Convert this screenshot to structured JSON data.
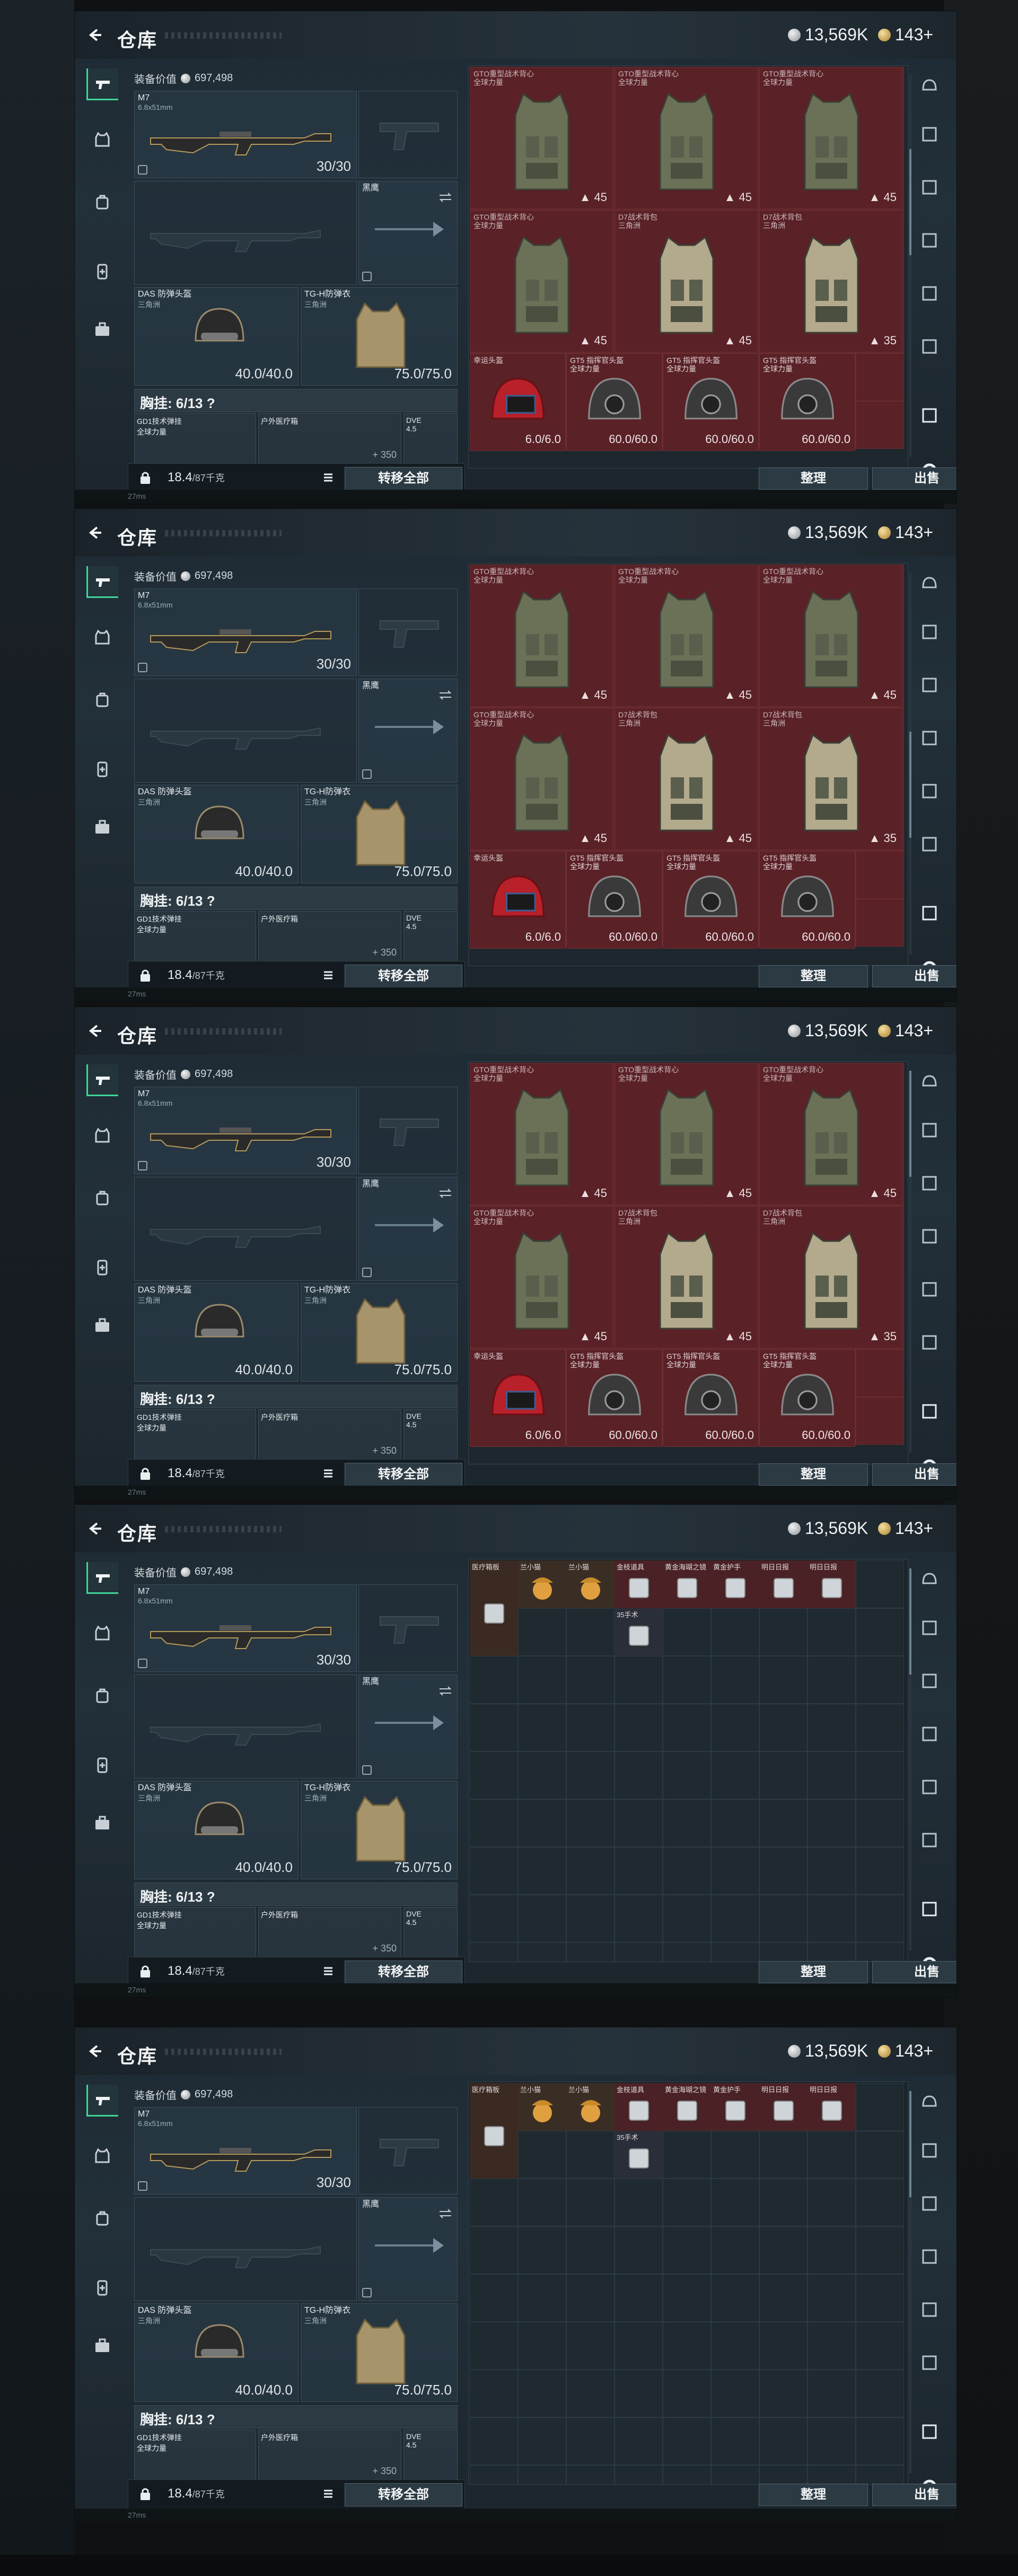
{
  "page": {
    "title": "仓库"
  },
  "currency": {
    "silver": "13,569K",
    "gold": "143+"
  },
  "equipment": {
    "label": "装备价值",
    "value": "697,498",
    "primary": {
      "name": "M7",
      "caliber": "6.8x51mm",
      "ammo": "30/30"
    },
    "secondary_tag": "黑鹰",
    "helmet": {
      "name": "DAS 防弹头盔",
      "sub": "三角洲",
      "durability": "40.0/40.0"
    },
    "armor": {
      "name": "TG-H防弹衣",
      "sub": "三角洲",
      "durability": "75.0/75.0"
    },
    "chest_rig": "胸挂: 6/13 ?",
    "chest_slots": [
      {
        "name": "GD1技术弹挂",
        "sub": "全球力量"
      },
      {
        "name": "户外医疗箱",
        "sub": ""
      },
      {
        "name": "DVE",
        "sub": "4.5"
      }
    ],
    "chest_value": "+ 350"
  },
  "weight": {
    "current": "18.4",
    "max": "/87千克"
  },
  "actions": {
    "transfer_all": "转移全部",
    "sort": "整理",
    "sell": "出售"
  },
  "grid_items_red": {
    "rigs": [
      {
        "name": "GTO重型战术背心",
        "sub": "全球力量",
        "level": "45"
      },
      {
        "name": "GTO重型战术背心",
        "sub": "全球力量",
        "level": "45"
      },
      {
        "name": "GTO重型战术背心",
        "sub": "全球力量",
        "level": "45"
      },
      {
        "name": "GTO重型战术背心",
        "sub": "全球力量",
        "level": "45"
      },
      {
        "name": "D7战术背包",
        "sub": "三角洲",
        "level": "45"
      },
      {
        "name": "D7战术背包",
        "sub": "三角洲",
        "level": "35"
      }
    ],
    "helmets": [
      {
        "name": "幸运头盔",
        "sub": "",
        "durability": "6.0/6.0"
      },
      {
        "name": "GT5 指挥官头盔",
        "sub": "全球力量",
        "durability": "60.0/60.0"
      },
      {
        "name": "GT5 指挥官头盔",
        "sub": "全球力量",
        "durability": "60.0/60.0"
      },
      {
        "name": "GT5 指挥官头盔",
        "sub": "全球力量",
        "durability": "60.0/60.0"
      }
    ]
  },
  "grid_items_misc": [
    {
      "name": "医疗箱板"
    },
    {
      "name": "兰小猫"
    },
    {
      "name": "兰小猫"
    },
    {
      "name": "金枝道具"
    },
    {
      "name": "黄金海瑚之镜"
    },
    {
      "name": "黄金护手"
    },
    {
      "name": "明日日报"
    },
    {
      "name": "明日日报"
    },
    {
      "name": "35手术"
    }
  ],
  "footer": {
    "text": "27ms"
  }
}
